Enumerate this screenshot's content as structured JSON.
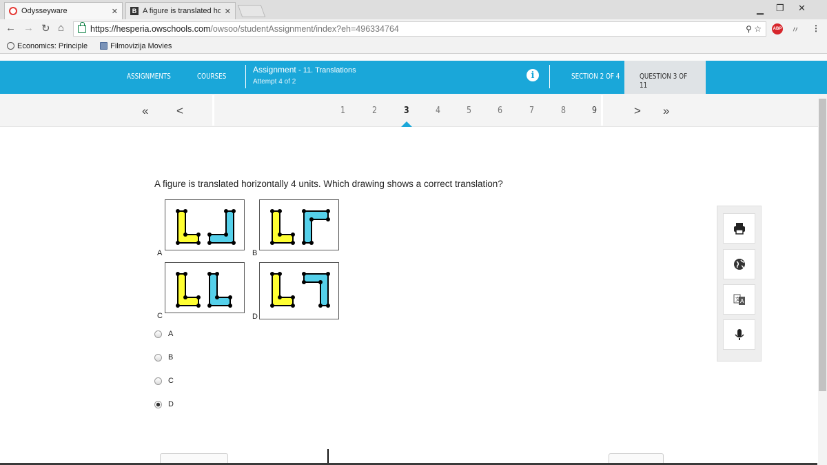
{
  "browser": {
    "tabs": [
      {
        "title": "Odysseyware"
      },
      {
        "title": "A figure is translated hor"
      }
    ],
    "url_host": "https://hesperia.owschools.com",
    "url_path": "/owsoo/studentAssignment/index?eh=496334764",
    "abp_label": "ABP",
    "bookmarks": [
      {
        "label": "Economics: Principle"
      },
      {
        "label": "Filmovizija Movies"
      }
    ]
  },
  "topnav": {
    "assignments": "ASSIGNMENTS",
    "courses": "COURSES",
    "assignment_label": "Assignment",
    "assignment_name": "- 11. Translations",
    "attempt": "Attempt 4 of 2",
    "section": "SECTION 2 OF 4",
    "question": "QUESTION 3 OF 11"
  },
  "qnav": {
    "first": "«",
    "prev": "‹",
    "next": ">",
    "last": "»",
    "numbers": [
      "1",
      "2",
      "3",
      "4",
      "5",
      "6",
      "7",
      "8",
      "9"
    ],
    "current": "3"
  },
  "question": {
    "text": "A figure is translated horizontally 4 units. Which drawing shows a correct translation?",
    "figure_labels": [
      "A",
      "B",
      "C",
      "D"
    ],
    "options": [
      "A",
      "B",
      "C",
      "D"
    ],
    "selected": "D"
  },
  "colors": {
    "brand": "#1aa7d9",
    "yellow": "#ffff33",
    "blue": "#55d0ea"
  },
  "tools": [
    "print-icon",
    "globe-icon",
    "translate-icon",
    "microphone-icon"
  ]
}
